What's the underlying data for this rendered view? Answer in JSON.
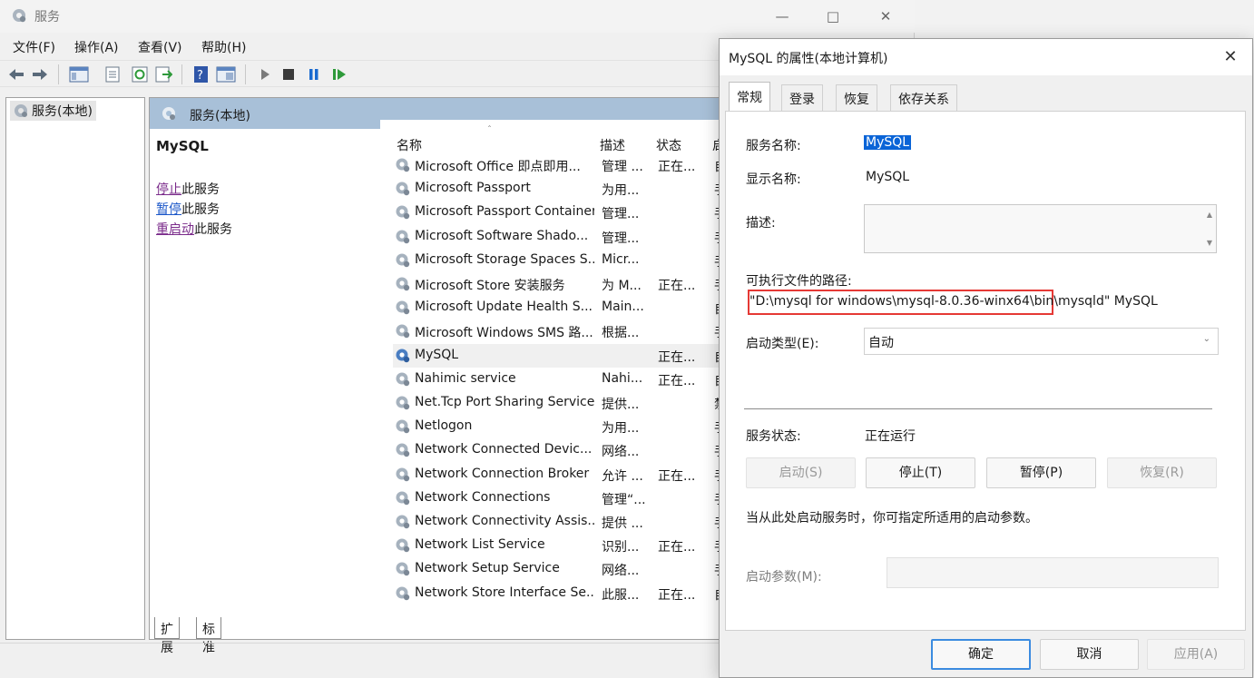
{
  "window": {
    "title": "服务",
    "icon": "gear-icon"
  },
  "menubar": [
    "文件(F)",
    "操作(A)",
    "查看(V)",
    "帮助(H)"
  ],
  "toolbar": {
    "icons": [
      "back-arrow-icon",
      "forward-arrow-icon",
      "show-hide-tree-icon",
      "properties-icon",
      "refresh-icon",
      "export-list-icon",
      "help-icon",
      "console-view-icon",
      "start-service-icon",
      "stop-service-icon",
      "pause-service-icon",
      "restart-service-icon"
    ]
  },
  "tree": {
    "node": "服务(本地)"
  },
  "panel": {
    "header": "服务(本地)",
    "selected_service": "MySQL",
    "actions": [
      {
        "link": "停止",
        "rest": "此服务"
      },
      {
        "link": "暂停",
        "rest": "此服务"
      },
      {
        "link": "重启动",
        "rest": "此服务"
      }
    ]
  },
  "list": {
    "columns": [
      "名称",
      "描述",
      "状态",
      "启"
    ],
    "rows": [
      {
        "name": "Microsoft Office 即点即用...",
        "desc": "管理 ...",
        "status": "正在...",
        "startup": "自"
      },
      {
        "name": "Microsoft Passport",
        "desc": "为用...",
        "status": "",
        "startup": "手"
      },
      {
        "name": "Microsoft Passport Container",
        "desc": "管理...",
        "status": "",
        "startup": "手"
      },
      {
        "name": "Microsoft Software Shado...",
        "desc": "管理...",
        "status": "",
        "startup": "手"
      },
      {
        "name": "Microsoft Storage Spaces S...",
        "desc": "Micr...",
        "status": "",
        "startup": "手"
      },
      {
        "name": "Microsoft Store 安装服务",
        "desc": "为 M...",
        "status": "正在...",
        "startup": "手"
      },
      {
        "name": "Microsoft Update Health S...",
        "desc": "Main...",
        "status": "",
        "startup": "自"
      },
      {
        "name": "Microsoft Windows SMS 路...",
        "desc": "根据...",
        "status": "",
        "startup": "手"
      },
      {
        "name": "MySQL",
        "desc": "",
        "status": "正在...",
        "startup": "自"
      },
      {
        "name": "Nahimic service",
        "desc": "Nahi...",
        "status": "正在...",
        "startup": "自"
      },
      {
        "name": "Net.Tcp Port Sharing Service",
        "desc": "提供...",
        "status": "",
        "startup": "禁"
      },
      {
        "name": "Netlogon",
        "desc": "为用...",
        "status": "",
        "startup": "手"
      },
      {
        "name": "Network Connected Devic...",
        "desc": "网络...",
        "status": "",
        "startup": "手"
      },
      {
        "name": "Network Connection Broker",
        "desc": "允许 ...",
        "status": "正在...",
        "startup": "手"
      },
      {
        "name": "Network Connections",
        "desc": "管理“...",
        "status": "",
        "startup": "手"
      },
      {
        "name": "Network Connectivity Assis...",
        "desc": "提供 ...",
        "status": "",
        "startup": "手"
      },
      {
        "name": "Network List Service",
        "desc": "识别...",
        "status": "正在...",
        "startup": "手"
      },
      {
        "name": "Network Setup Service",
        "desc": "网络...",
        "status": "",
        "startup": "手"
      },
      {
        "name": "Network Store Interface Se...",
        "desc": "此服...",
        "status": "正在...",
        "startup": "自"
      }
    ]
  },
  "bottom_tabs": [
    "扩展",
    "标准"
  ],
  "dialog": {
    "title": "MySQL 的属性(本地计算机)",
    "tabs": [
      "常规",
      "登录",
      "恢复",
      "依存关系"
    ],
    "service_name_label": "服务名称:",
    "service_name": "MySQL",
    "display_name_label": "显示名称:",
    "display_name": "MySQL",
    "description_label": "描述:",
    "path_label": "可执行文件的路径:",
    "path_value": "\"D:\\mysql for windows\\mysql-8.0.36-winx64\\bin\\mysqld\" MySQL",
    "startup_type_label": "启动类型(E):",
    "startup_type": "自动",
    "status_label": "服务状态:",
    "status": "正在运行",
    "buttons": {
      "start": "启动(S)",
      "stop": "停止(T)",
      "pause": "暂停(P)",
      "resume": "恢复(R)"
    },
    "hint": "当从此处启动服务时，你可指定所适用的启动参数。",
    "params_label": "启动参数(M):",
    "ok": "确定",
    "cancel": "取消",
    "apply": "应用(A)"
  }
}
